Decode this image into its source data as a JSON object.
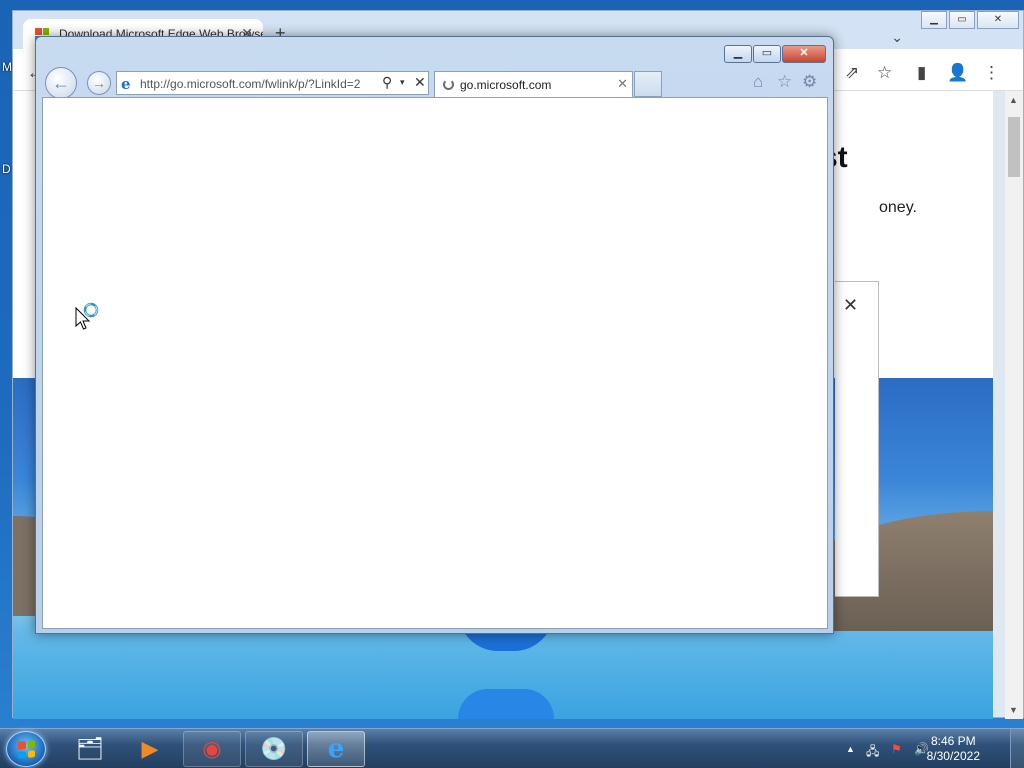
{
  "desktop": {
    "labels": [
      "M",
      "D"
    ]
  },
  "chrome": {
    "tab_title": "Download Microsoft Edge Web Browser",
    "tab_close": "✕",
    "new_tab": "+",
    "chevron": "⌄",
    "caption": {
      "minimize": "▁",
      "maximize": "▭",
      "close": "✕"
    },
    "toolbar_icons": {
      "back": "←",
      "share": "⇗",
      "star": "☆",
      "sidepanel": "▮",
      "profile": "👤",
      "menu": "⋮"
    },
    "hero_fragment": "st",
    "body_fragment": "oney.",
    "dialog_close": "✕",
    "scroll_up": "▲",
    "scroll_down": "▼",
    "ms_logo_colors": [
      "#f25022",
      "#7fba00",
      "#00a4ef",
      "#ffb900"
    ]
  },
  "ie": {
    "caption": {
      "minimize": "▁",
      "maximize": "▭",
      "close": "✕"
    },
    "back_glyph": "←",
    "forward_glyph": "→",
    "favicon": "e",
    "address_url": "http://go.microsoft.com/fwlink/p/?LinkId=2",
    "search_glyph": "⚲",
    "dropdown_glyph": "▾",
    "stop_glyph": "✕",
    "tab_title": "go.microsoft.com",
    "tab_close": "✕",
    "commands": {
      "home": "⌂",
      "favorites": "☆",
      "tools": "⚙"
    }
  },
  "taskbar": {
    "start_flag_colors": [
      "#f25022",
      "#7fba00",
      "#00a4ef",
      "#ffb900"
    ],
    "pinned": [
      {
        "name": "explorer",
        "glyph": "🗂"
      },
      {
        "name": "media-player",
        "glyph": "▶"
      },
      {
        "name": "chrome",
        "glyph": "◉"
      },
      {
        "name": "media-center",
        "glyph": "💿"
      },
      {
        "name": "internet-explorer",
        "glyph": "e"
      }
    ],
    "tray": {
      "arrow": "▲",
      "network": "🖧",
      "action_center": "⚑",
      "volume": "🔊"
    },
    "time": "8:46 PM",
    "date": "8/30/2022"
  }
}
